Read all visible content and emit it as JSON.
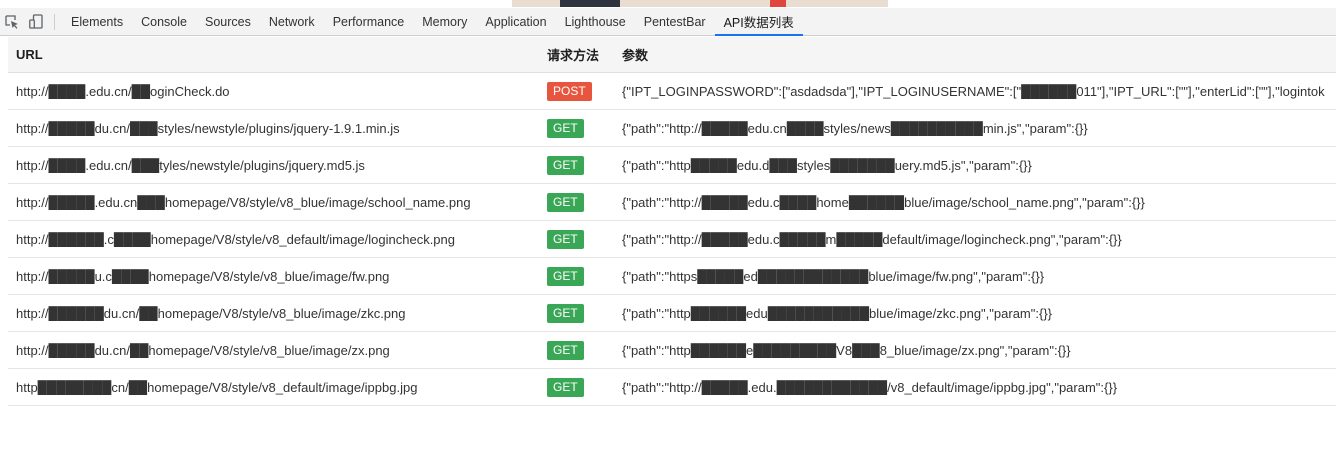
{
  "toolbar": {
    "tabs": [
      {
        "label": "Elements",
        "active": false
      },
      {
        "label": "Console",
        "active": false
      },
      {
        "label": "Sources",
        "active": false
      },
      {
        "label": "Network",
        "active": false
      },
      {
        "label": "Performance",
        "active": false
      },
      {
        "label": "Memory",
        "active": false
      },
      {
        "label": "Application",
        "active": false
      },
      {
        "label": "Lighthouse",
        "active": false
      },
      {
        "label": "PentestBar",
        "active": false
      },
      {
        "label": "API数据列表",
        "active": true
      }
    ]
  },
  "table": {
    "headers": {
      "url": "URL",
      "method": "请求方法",
      "params": "参数"
    },
    "method_colors": {
      "POST": "#e8553e",
      "GET": "#3aa757"
    },
    "rows": [
      {
        "url": "http://████.edu.cn/██oginCheck.do",
        "method": "POST",
        "params": "{\"IPT_LOGINPASSWORD\":[\"asdadsda\"],\"IPT_LOGINUSERNAME\":[\"██████011\"],\"IPT_URL\":[\"\"],\"enterLid\":[\"\"],\"logintok"
      },
      {
        "url": "http://█████du.cn/███styles/newstyle/plugins/jquery-1.9.1.min.js",
        "method": "GET",
        "params": "{\"path\":\"http://█████edu.cn████styles/news██████████min.js\",\"param\":{}}"
      },
      {
        "url": "http://████.edu.cn/███tyles/newstyle/plugins/jquery.md5.js",
        "method": "GET",
        "params": "{\"path\":\"http█████edu.d███styles███████uery.md5.js\",\"param\":{}}"
      },
      {
        "url": "http://█████.edu.cn███homepage/V8/style/v8_blue/image/school_name.png",
        "method": "GET",
        "params": "{\"path\":\"http://█████edu.c████home██████blue/image/school_name.png\",\"param\":{}}"
      },
      {
        "url": "http://██████.c████homepage/V8/style/v8_default/image/logincheck.png",
        "method": "GET",
        "params": "{\"path\":\"http://█████edu.c█████m█████default/image/logincheck.png\",\"param\":{}}"
      },
      {
        "url": "http://█████u.c████homepage/V8/style/v8_blue/image/fw.png",
        "method": "GET",
        "params": "{\"path\":\"https█████ed████████████blue/image/fw.png\",\"param\":{}}"
      },
      {
        "url": "http://██████du.cn/██homepage/V8/style/v8_blue/image/zkc.png",
        "method": "GET",
        "params": "{\"path\":\"http██████edu███████████blue/image/zkc.png\",\"param\":{}}"
      },
      {
        "url": "http://█████du.cn/██homepage/V8/style/v8_blue/image/zx.png",
        "method": "GET",
        "params": "{\"path\":\"http██████e█████████V8███8_blue/image/zx.png\",\"param\":{}}"
      },
      {
        "url": "http████████cn/██homepage/V8/style/v8_default/image/ippbg.jpg",
        "method": "GET",
        "params": "{\"path\":\"http://█████.edu.████████████/v8_default/image/ippbg.jpg\",\"param\":{}}"
      }
    ]
  }
}
